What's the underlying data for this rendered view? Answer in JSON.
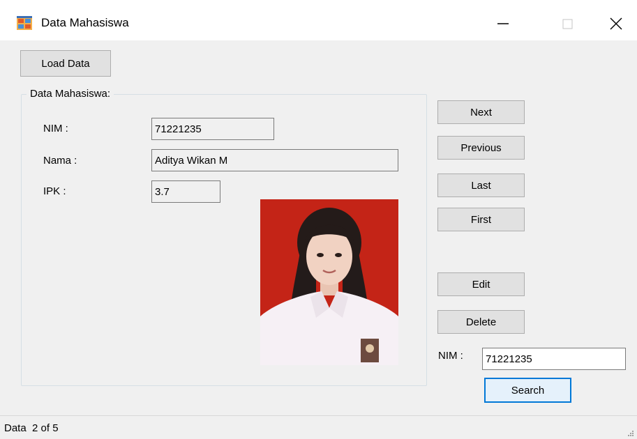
{
  "window": {
    "title": "Data Mahasiswa",
    "icons": {
      "app": "form-app-icon",
      "minimize": "minimize-icon",
      "maximize": "maximize-icon",
      "close": "close-icon"
    }
  },
  "toolbar": {
    "load_label": "Load Data"
  },
  "group": {
    "title": "Data Mahasiswa:",
    "fields": {
      "nim_label": "NIM :",
      "nim_value": "71221235",
      "nama_label": "Nama :",
      "nama_value": "Aditya Wikan M",
      "ipk_label": "IPK :",
      "ipk_value": "3.7"
    },
    "photo": {
      "icon": "student-photo"
    }
  },
  "nav": {
    "next": "Next",
    "previous": "Previous",
    "last": "Last",
    "first": "First"
  },
  "actions": {
    "edit": "Edit",
    "delete": "Delete"
  },
  "search": {
    "nim_label": "NIM :",
    "nim_value": "71221235",
    "button": "Search"
  },
  "status": {
    "text": "Data  2 of 5"
  },
  "colors": {
    "window_bg": "#f0f0f0",
    "button_bg": "#e1e1e1",
    "focus_border": "#0078d7",
    "photo_bg": "#c42417"
  }
}
